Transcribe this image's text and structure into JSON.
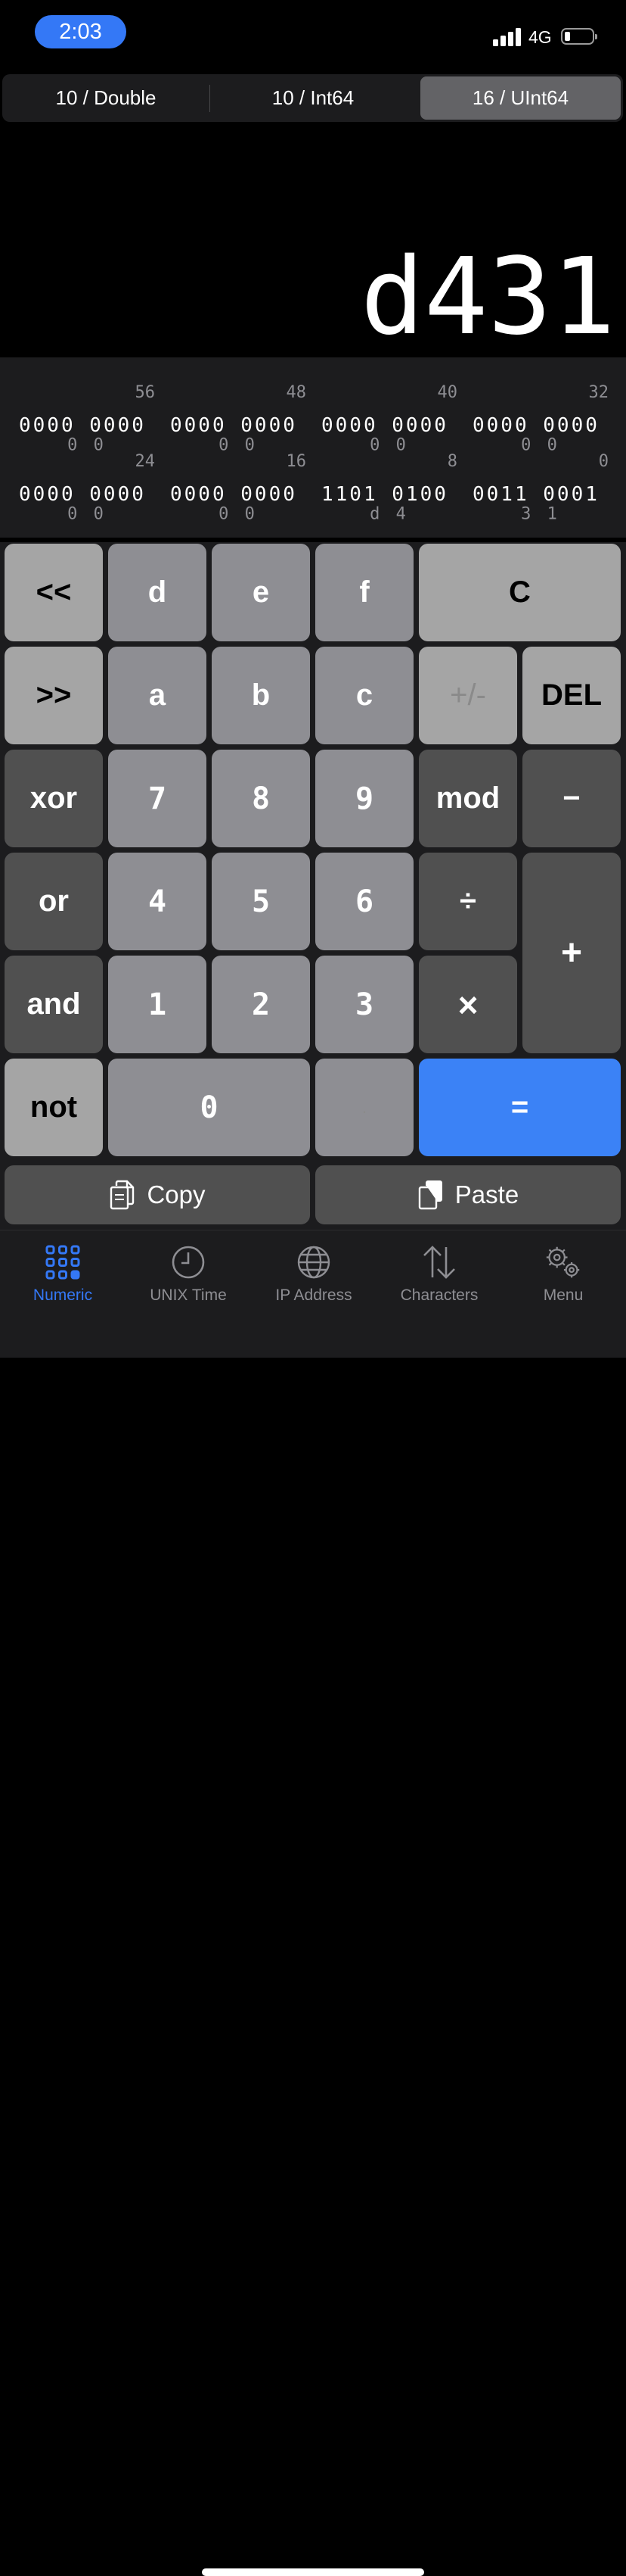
{
  "status_bar": {
    "time": "2:03",
    "network": "4G",
    "battery_level": 0.2
  },
  "modes": [
    {
      "label": "10 / Double",
      "selected": false
    },
    {
      "label": "10 / Int64",
      "selected": false
    },
    {
      "label": "16 / UInt64",
      "selected": true
    }
  ],
  "display": {
    "value": "d431"
  },
  "bits": [
    {
      "pos": "56",
      "bin": "0000 0000",
      "hex": "0 0"
    },
    {
      "pos": "48",
      "bin": "0000 0000",
      "hex": "0 0"
    },
    {
      "pos": "40",
      "bin": "0000 0000",
      "hex": "0 0"
    },
    {
      "pos": "32",
      "bin": "0000 0000",
      "hex": "0 0"
    },
    {
      "pos": "24",
      "bin": "0000 0000",
      "hex": "0 0"
    },
    {
      "pos": "16",
      "bin": "0000 0000",
      "hex": "0 0"
    },
    {
      "pos": "8",
      "bin": "1101 0100",
      "hex": "d 4"
    },
    {
      "pos": "0",
      "bin": "0011 0001",
      "hex": "3 1"
    }
  ],
  "keys": {
    "shl": "<<",
    "d": "d",
    "e": "e",
    "f": "f",
    "clear": "C",
    "shr": ">>",
    "a": "a",
    "b": "b",
    "c": "c",
    "negate": "+/-",
    "del": "DEL",
    "xor": "xor",
    "k7": "7",
    "k8": "8",
    "k9": "9",
    "mod": "mod",
    "minus": "−",
    "or": "or",
    "k4": "4",
    "k5": "5",
    "k6": "6",
    "divide": "÷",
    "plus": "+",
    "and": "and",
    "k1": "1",
    "k2": "2",
    "k3": "3",
    "multiply": "×",
    "not": "not",
    "k0": "0",
    "dot": ".",
    "equals": "="
  },
  "actions": {
    "copy": "Copy",
    "paste": "Paste"
  },
  "tabs": [
    {
      "label": "Numeric",
      "icon": "grid-icon",
      "active": true
    },
    {
      "label": "UNIX Time",
      "icon": "clock-icon",
      "active": false
    },
    {
      "label": "IP Address",
      "icon": "globe-icon",
      "active": false
    },
    {
      "label": "Characters",
      "icon": "arrows-up-down-icon",
      "active": false
    },
    {
      "label": "Menu",
      "icon": "gears-icon",
      "active": false
    }
  ],
  "colors": {
    "accent": "#3478f6",
    "equals_key": "#3b82f6",
    "light_key": "#a5a5a5",
    "mid_key": "#8e8e93",
    "dark_key": "#505050"
  }
}
